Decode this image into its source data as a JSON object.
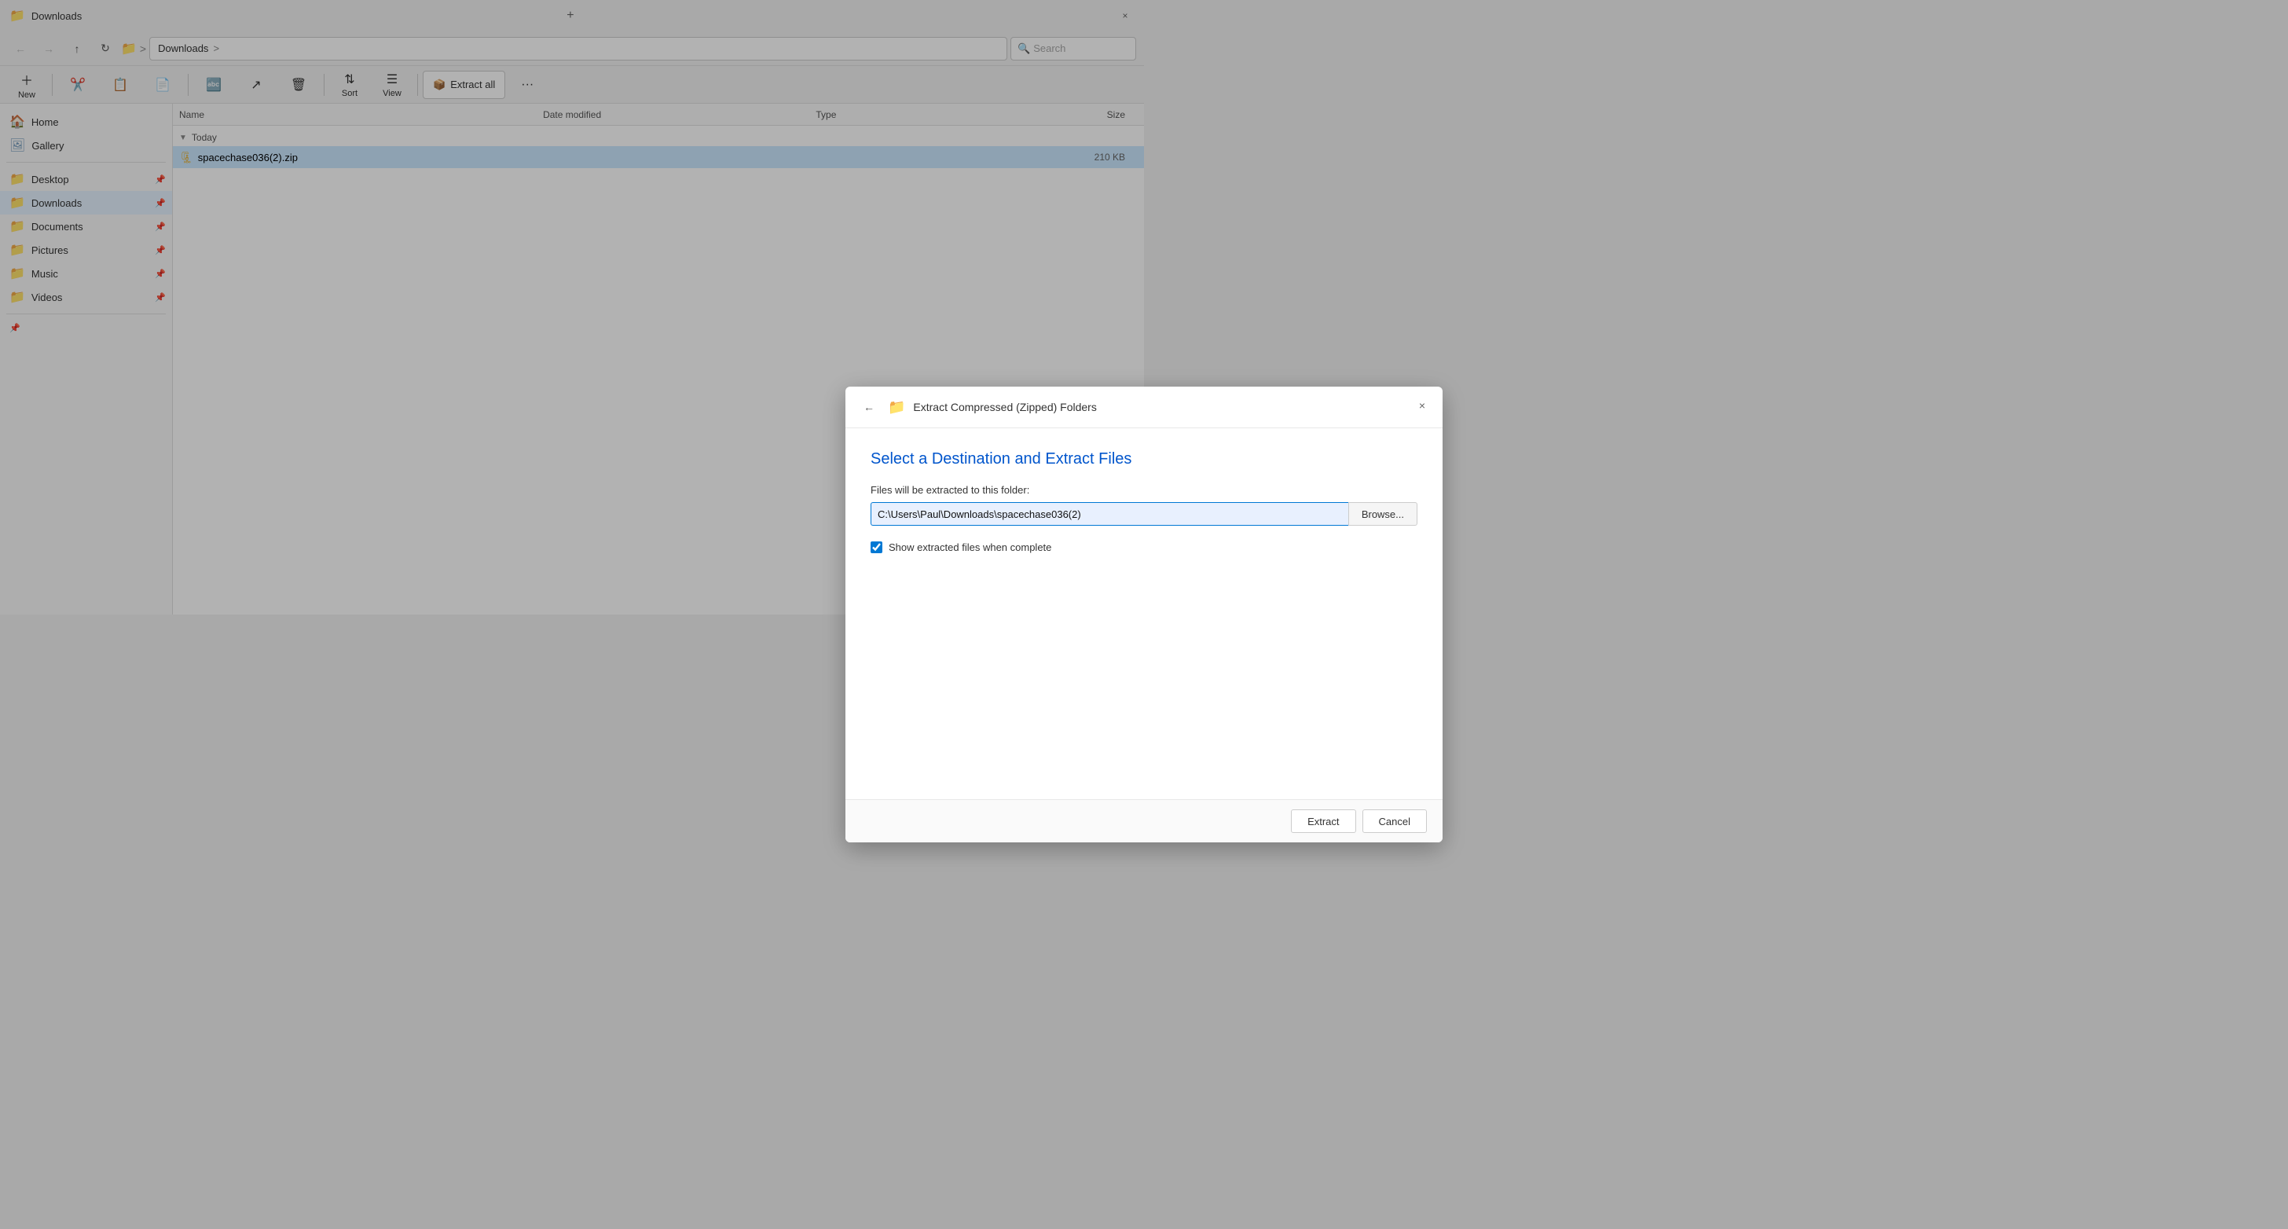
{
  "titlebar": {
    "icon": "📁",
    "title": "Downloads",
    "close_label": "×",
    "add_tab_label": "+"
  },
  "navbar": {
    "back_label": "←",
    "forward_label": "→",
    "up_label": "↑",
    "refresh_label": "↻",
    "folder_label": "📁",
    "path_root_label": ">",
    "path_location": "Downloads",
    "path_arrow": ">",
    "search_placeholder": "Search"
  },
  "toolbar": {
    "new_label": "New",
    "new_arrow": "∨",
    "cut_label": "Cut",
    "copy_label": "Copy",
    "paste_label": "Paste",
    "rename_label": "Rename",
    "share_label": "Share",
    "delete_label": "Delete",
    "sort_label": "Sort",
    "sort_arrow": "∨",
    "view_label": "View",
    "view_arrow": "∨",
    "extract_icon": "📦",
    "extract_label": "Extract all",
    "more_label": "···"
  },
  "file_columns": {
    "name": "Name",
    "date": "Date modified",
    "type": "Type",
    "size": "Size"
  },
  "sidebar": {
    "items": [
      {
        "id": "home",
        "label": "Home",
        "icon": "🏠",
        "pinnable": false
      },
      {
        "id": "gallery",
        "label": "Gallery",
        "icon": "🖼",
        "pinnable": false
      },
      {
        "id": "desktop",
        "label": "Desktop",
        "icon": "📁",
        "pinnable": true
      },
      {
        "id": "downloads",
        "label": "Downloads",
        "icon": "📁",
        "pinnable": true,
        "active": true
      },
      {
        "id": "documents",
        "label": "Documents",
        "icon": "📁",
        "pinnable": true
      },
      {
        "id": "pictures",
        "label": "Pictures",
        "icon": "📁",
        "pinnable": true
      },
      {
        "id": "music",
        "label": "Music",
        "icon": "📁",
        "pinnable": true
      },
      {
        "id": "videos",
        "label": "Videos",
        "icon": "📁",
        "pinnable": true
      }
    ]
  },
  "file_list": {
    "section_today": "Today",
    "files": [
      {
        "name": "spacechase036(2).zip",
        "date": "",
        "type": "",
        "size": "210 KB",
        "selected": true
      }
    ]
  },
  "modal": {
    "back_label": "←",
    "zip_icon": "📁",
    "title": "Extract Compressed (Zipped) Folders",
    "close_label": "×",
    "heading": "Select a Destination and Extract Files",
    "folder_label": "Files will be extracted to this folder:",
    "path_value": "C:\\Users\\Paul\\Downloads\\spacechase036(2)",
    "browse_label": "Browse...",
    "show_files_checked": true,
    "show_files_label": "Show extracted files when complete",
    "extract_label": "Extract",
    "cancel_label": "Cancel"
  }
}
